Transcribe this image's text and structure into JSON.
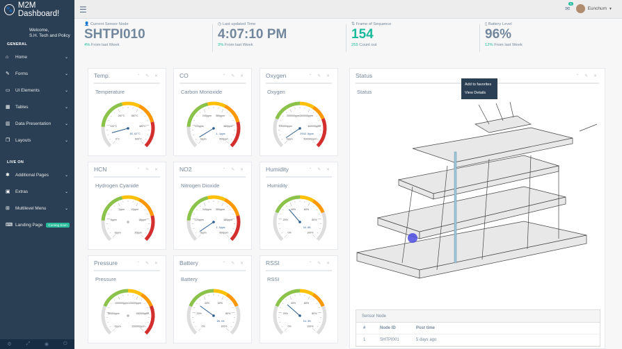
{
  "app": {
    "title": "M2M Dashboard!"
  },
  "profile": {
    "welcome": "Welcome,",
    "name": "S.H. Tech and Policy"
  },
  "sidebar": {
    "general_title": "GENERAL",
    "general_items": [
      {
        "label": "Home",
        "icon": "home-icon"
      },
      {
        "label": "Forms",
        "icon": "edit-icon"
      },
      {
        "label": "UI Elements",
        "icon": "desktop-icon"
      },
      {
        "label": "Tables",
        "icon": "table-icon"
      },
      {
        "label": "Data Presentation",
        "icon": "bar-chart-icon"
      },
      {
        "label": "Layouts",
        "icon": "clone-icon"
      }
    ],
    "live_title": "LIVE ON",
    "live_items": [
      {
        "label": "Additional Pages",
        "icon": "bug-icon"
      },
      {
        "label": "Extras",
        "icon": "windows-icon"
      },
      {
        "label": "Multilevel Menu",
        "icon": "sitemap-icon"
      },
      {
        "label": "Landing Page",
        "icon": "laptop-icon",
        "badge": "Coming Soon"
      }
    ]
  },
  "topnav": {
    "mail_count": "6",
    "user": "Eunchum"
  },
  "tiles": [
    {
      "title": "Current Sensor Node",
      "value": "SHTPI010",
      "foot_accent": "4%",
      "foot": "From last Week",
      "green": false
    },
    {
      "title": "Last updated Time",
      "value": "4:07:10 PM",
      "foot_accent": "3%",
      "foot": "From last Week",
      "green": false
    },
    {
      "title": "Frame of Sequence",
      "value": "154",
      "foot_accent": "255",
      "foot": "Count out",
      "green": true
    },
    {
      "title": "Battery Level",
      "value": "96%",
      "foot_accent": "12%",
      "foot": "From last Week",
      "green": false
    }
  ],
  "panels": [
    {
      "title": "Temp.",
      "sub": "Temperature",
      "labels": [
        "0°C",
        "120°C",
        "240°C",
        "360°C",
        "480°C",
        "600°C"
      ],
      "readout": "65.62°C",
      "value": 0.11
    },
    {
      "title": "CO",
      "sub": "Carbon Monoxide",
      "labels": [
        "0ppm",
        "120ppm",
        "240ppm",
        "360ppm",
        "480ppm",
        "600ppm"
      ],
      "readout": "1.1ppm",
      "value": 0.05
    },
    {
      "title": "Oxygen",
      "sub": "Oxygen",
      "labels": [
        "0ppm",
        "100000ppm",
        "200000ppm",
        "300000ppm",
        "400000ppm",
        "500000ppm"
      ],
      "readout": "2042.8ppm",
      "value": 0.04
    },
    {
      "title": "HCN",
      "sub": "Hydrogen Cyanide",
      "labels": [
        "0ppm",
        "6ppm",
        "7ppm",
        "12ppm",
        "18ppm",
        "20ppm"
      ],
      "readout": "",
      "value": 0.0
    },
    {
      "title": "NO2",
      "sub": "Nitrogen Dioxide",
      "labels": [
        "0ppm",
        "120ppm",
        "240ppm",
        "360ppm",
        "480ppm",
        "600ppm"
      ],
      "readout": "1.5ppm",
      "value": 0.04
    },
    {
      "title": "Humidity",
      "sub": "Humidity",
      "labels": [
        "0%",
        "20%",
        "40%",
        "60%",
        "80%",
        "100%"
      ],
      "readout": "34.8%",
      "value": 0.35
    },
    {
      "title": "Pressure",
      "sub": "Pressure",
      "labels": [
        "0ppm",
        "50000ppm",
        "100000ppm",
        "120000ppm",
        "150000ppm",
        "200000ppm"
      ],
      "readout": "",
      "value": 0.0
    },
    {
      "title": "Battery",
      "sub": "Battery",
      "labels": [
        "0%",
        "20%",
        "40%",
        "60%",
        "80%",
        "100%"
      ],
      "readout": "96.5%",
      "value": 0.3
    },
    {
      "title": "RSSI",
      "sub": "RSSI",
      "labels": [
        "0%",
        "20%",
        "40%",
        "60%",
        "80%",
        "100%"
      ],
      "readout": "54.3%",
      "value": 0.32
    }
  ],
  "status": {
    "title": "Status",
    "sub": "Status",
    "tooltip": [
      "Add to favorites",
      "View Details"
    ],
    "table": {
      "title": "Sensor Node",
      "headers": [
        "#",
        "Node ID",
        "Post time"
      ],
      "rows": [
        [
          "1",
          "SHTPI001",
          "5 days ago"
        ]
      ]
    }
  },
  "colors": {
    "sidebar": "#2A3F54",
    "accent": "#1ABB9C",
    "text": "#73879C"
  }
}
